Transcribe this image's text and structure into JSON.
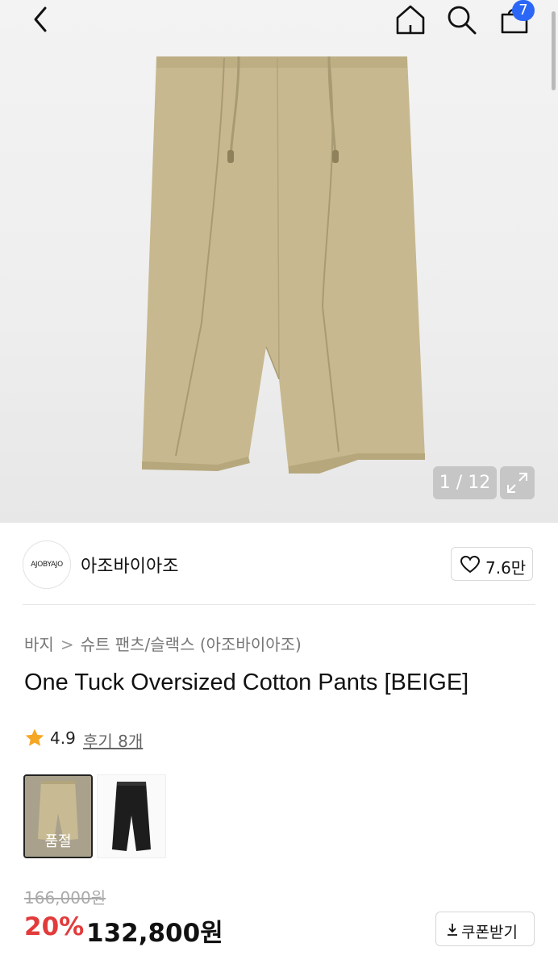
{
  "header": {
    "cart_count": "7",
    "icons": [
      "back-icon",
      "home-icon",
      "search-icon",
      "bag-icon"
    ]
  },
  "gallery": {
    "pager": "1 / 12",
    "main_color": "#c7b88f"
  },
  "brand": {
    "logo_text": "AJOBYAJO",
    "name": "아조바이아조",
    "like_count": "7.6만"
  },
  "breadcrumb": {
    "category": "바지",
    "subcategory": "슈트 팬츠/슬랙스 (아조바이아조)"
  },
  "product": {
    "title": "One Tuck Oversized Cotton Pants [BEIGE]",
    "rating": "4.9",
    "reviews_label": "후기 8개",
    "swatches": [
      {
        "color": "beige",
        "soldout_label": "품절"
      },
      {
        "color": "black"
      }
    ]
  },
  "price": {
    "original": "166,000원",
    "discount": "20%",
    "final": "132,800원",
    "coupon_label": "쿠폰받기"
  },
  "colors": {
    "discount_red": "#e23b3b",
    "badge_blue": "#2b67f6",
    "star_orange": "#f5a623"
  }
}
